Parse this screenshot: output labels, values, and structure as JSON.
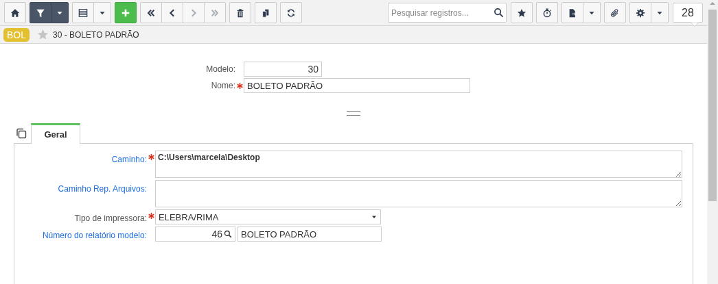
{
  "toolbar": {
    "groups": [
      [
        {
          "kind": "home",
          "disabled": false
        }
      ],
      [
        {
          "kind": "filter",
          "disabled": false
        },
        {
          "kind": "dropdown",
          "disabled": false,
          "dark": true
        }
      ],
      [
        {
          "kind": "grid",
          "disabled": false
        },
        {
          "kind": "dropdown",
          "disabled": false,
          "dark": false
        }
      ],
      [
        {
          "kind": "add",
          "disabled": false
        }
      ],
      [
        {
          "kind": "first",
          "disabled": false
        },
        {
          "kind": "prev",
          "disabled": false
        },
        {
          "kind": "next",
          "disabled": true
        },
        {
          "kind": "last",
          "disabled": true
        }
      ],
      [
        {
          "kind": "delete",
          "disabled": false
        }
      ],
      [
        {
          "kind": "copy",
          "disabled": false
        }
      ],
      [
        {
          "kind": "refresh",
          "disabled": false
        }
      ]
    ],
    "search": {
      "placeholder": "Pesquisar registros..."
    },
    "right_groups": [
      [
        {
          "kind": "star",
          "disabled": false
        }
      ],
      [
        {
          "kind": "timer",
          "disabled": false
        }
      ],
      [
        {
          "kind": "export",
          "disabled": false
        },
        {
          "kind": "dropdown",
          "disabled": false,
          "dark": false
        }
      ],
      [
        {
          "kind": "attach",
          "disabled": false
        }
      ],
      [
        {
          "kind": "settings",
          "disabled": false
        },
        {
          "kind": "dropdown",
          "disabled": false,
          "dark": false
        }
      ]
    ],
    "record_count": "28"
  },
  "breadcrumb": {
    "badge": "BOL",
    "favorite": false,
    "title": "30 - BOLETO PADRÃO"
  },
  "header_fields": [
    {
      "label": "Modelo:",
      "required": false,
      "kind": "number",
      "value": "30"
    },
    {
      "label": "Nome:",
      "required": true,
      "kind": "text",
      "value": "BOLETO PADRÃO"
    }
  ],
  "tabs": [
    {
      "label": "Geral",
      "selected": true
    }
  ],
  "fields": [
    {
      "label": "Caminho:",
      "required": true,
      "link": true,
      "kind": "textarea",
      "value": "C:\\Users\\marcela\\Desktop"
    },
    {
      "label": "Caminho Rep. Arquivos:",
      "required": false,
      "link": true,
      "kind": "textarea"
    },
    {
      "label": "Tipo de impressora:",
      "required": true,
      "link": false,
      "kind": "select",
      "value": "ELEBRA/RIMA"
    },
    {
      "label": "Número do relatório modelo:",
      "required": false,
      "link": true,
      "kind": "lookup",
      "value": "46",
      "description": "BOLETO PADRÃO"
    }
  ]
}
